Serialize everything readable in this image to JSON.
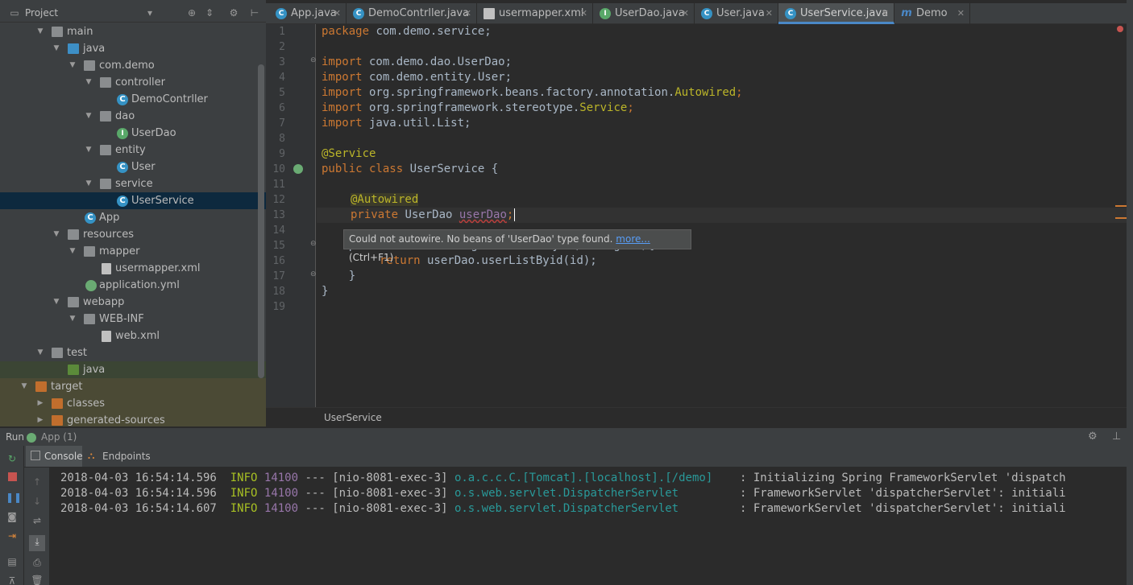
{
  "project_panel": {
    "title": "Project",
    "tree": [
      {
        "label": "main",
        "icon": "folder"
      },
      {
        "label": "java",
        "icon": "folder-blue"
      },
      {
        "label": "com.demo",
        "icon": "package"
      },
      {
        "label": "controller",
        "icon": "package"
      },
      {
        "label": "DemoContrller",
        "icon": "class"
      },
      {
        "label": "dao",
        "icon": "package"
      },
      {
        "label": "UserDao",
        "icon": "interface"
      },
      {
        "label": "entity",
        "icon": "package"
      },
      {
        "label": "User",
        "icon": "class"
      },
      {
        "label": "service",
        "icon": "package"
      },
      {
        "label": "UserService",
        "icon": "class"
      },
      {
        "label": "App",
        "icon": "spring-class"
      },
      {
        "label": "resources",
        "icon": "folder"
      },
      {
        "label": "mapper",
        "icon": "folder"
      },
      {
        "label": "usermapper.xml",
        "icon": "xml"
      },
      {
        "label": "application.yml",
        "icon": "spring-config"
      },
      {
        "label": "webapp",
        "icon": "folder"
      },
      {
        "label": "WEB-INF",
        "icon": "folder"
      },
      {
        "label": "web.xml",
        "icon": "xml"
      },
      {
        "label": "test",
        "icon": "folder"
      },
      {
        "label": "java",
        "icon": "folder-green"
      },
      {
        "label": "target",
        "icon": "folder-orange"
      },
      {
        "label": "classes",
        "icon": "folder-orange"
      },
      {
        "label": "generated-sources",
        "icon": "folder-orange"
      }
    ]
  },
  "tabs": [
    {
      "label": "App.java",
      "icon": "spring-class"
    },
    {
      "label": "DemoContrller.java",
      "icon": "class"
    },
    {
      "label": "usermapper.xml",
      "icon": "xml"
    },
    {
      "label": "UserDao.java",
      "icon": "interface"
    },
    {
      "label": "User.java",
      "icon": "class"
    },
    {
      "label": "UserService.java",
      "icon": "class"
    },
    {
      "label": "Demo",
      "icon": "maven"
    }
  ],
  "editor": {
    "line_numbers": [
      "1",
      "2",
      "3",
      "4",
      "5",
      "6",
      "7",
      "8",
      "9",
      "10",
      "11",
      "12",
      "13",
      "14",
      "15",
      "16",
      "17",
      "18",
      "19"
    ],
    "code": {
      "l1a": "package",
      "l1b": " com.demo.service;",
      "l3a": "import",
      "l3b": " com.demo.dao.UserDao;",
      "l4a": "import",
      "l4b": " com.demo.entity.User;",
      "l5a": "import",
      "l5b": " org.springframework.beans.factory.annotation.",
      "l5c": "Autowired",
      "l5d": ";",
      "l6a": "import",
      "l6b": " org.springframework.stereotype.",
      "l6c": "Service",
      "l6d": ";",
      "l7a": "import",
      "l7b": " java.util.List;",
      "l9": "@Service",
      "l10a": "public class",
      "l10b": " UserService {",
      "l12": "@Autowired",
      "l13a": "private",
      "l13b": " UserDao ",
      "l13c": "userDao",
      "l13d": ";",
      "l15": "    public List<User> getUserListById(String id){",
      "l16a": "return",
      "l16b": " userDao.userListByid(id);",
      "l17": "    }",
      "l18": "}"
    },
    "tooltip": {
      "text": "Could not autowire. No beans of 'UserDao' type found.",
      "link": "more...",
      "shortcut": "(Ctrl+F1)"
    },
    "breadcrumb": "UserService"
  },
  "run_panel": {
    "run_label": "Run",
    "config": "App (1)",
    "tabs": [
      "Console",
      "Endpoints"
    ],
    "logs": [
      {
        "ts": "2018-04-03 16:54:14.596",
        "level": "INFO",
        "pid": "14100",
        "sep": "---",
        "thread": "[nio-8081-exec-3]",
        "cls": "o.a.c.c.C.[Tomcat].[localhost].[/demo]",
        "msg": ": Initializing Spring FrameworkServlet 'dispatch"
      },
      {
        "ts": "2018-04-03 16:54:14.596",
        "level": "INFO",
        "pid": "14100",
        "sep": "---",
        "thread": "[nio-8081-exec-3]",
        "cls": "o.s.web.servlet.DispatcherServlet",
        "msg": ": FrameworkServlet 'dispatcherServlet': initiali"
      },
      {
        "ts": "2018-04-03 16:54:14.607",
        "level": "INFO",
        "pid": "14100",
        "sep": "---",
        "thread": "[nio-8081-exec-3]",
        "cls": "o.s.web.servlet.DispatcherServlet",
        "msg": ": FrameworkServlet 'dispatcherServlet': initiali"
      }
    ]
  },
  "colors": {
    "selection": "#0d293e",
    "tab_accent": "#4a88c7",
    "keyword": "#cc7832",
    "annotation": "#bbb529",
    "field": "#9876aa"
  }
}
